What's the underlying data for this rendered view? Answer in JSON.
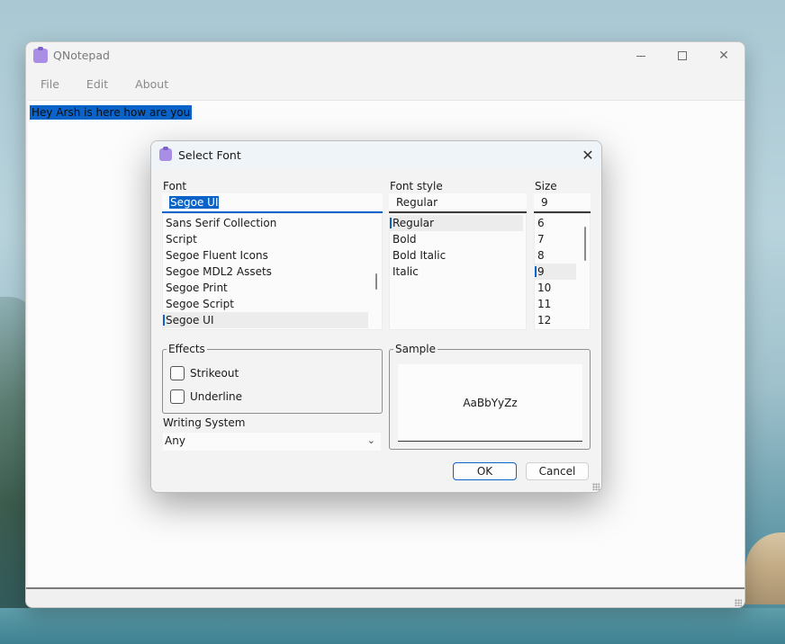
{
  "window": {
    "title": "QNotepad",
    "menu": [
      "File",
      "Edit",
      "About"
    ],
    "editor_text": "Hey Arsh is here how are you"
  },
  "dialog": {
    "title": "Select Font",
    "font": {
      "label": "Font",
      "value": "Segoe UI",
      "items": [
        "Sans Serif Collection",
        "Script",
        "Segoe Fluent Icons",
        "Segoe MDL2 Assets",
        "Segoe Print",
        "Segoe Script",
        "Segoe UI"
      ],
      "selected": "Segoe UI"
    },
    "style": {
      "label": "Font style",
      "value": "Regular",
      "items": [
        "Regular",
        "Bold",
        "Bold Italic",
        "Italic"
      ],
      "selected": "Regular"
    },
    "size": {
      "label": "Size",
      "value": "9",
      "items": [
        "6",
        "7",
        "8",
        "9",
        "10",
        "11",
        "12"
      ],
      "selected": "9"
    },
    "effects": {
      "label": "Effects",
      "strikeout": "Strikeout",
      "underline": "Underline"
    },
    "sample": {
      "label": "Sample",
      "text": "AaBbYyZz"
    },
    "writing_system": {
      "label": "Writing System",
      "value": "Any"
    },
    "buttons": {
      "ok": "OK",
      "cancel": "Cancel"
    }
  },
  "colors": {
    "accent": "#0a63c9",
    "app_icon": "#a98ee6"
  },
  "icons": {
    "app": "clipboard-icon",
    "minimize": "minimize-icon",
    "maximize": "maximize-icon",
    "close": "close-icon",
    "dropdown": "chevron-down-icon"
  }
}
